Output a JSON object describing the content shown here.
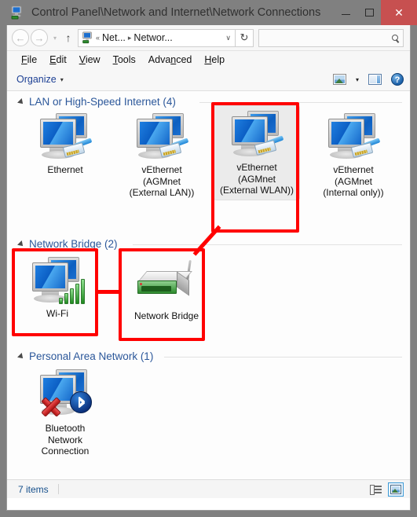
{
  "window": {
    "title": "Control Panel\\Network and Internet\\Network Connections",
    "icon": "network-connections-icon",
    "minimize_label": "–",
    "maximize_label": "",
    "close_label": "✕"
  },
  "addressbar": {
    "back_label": "←",
    "forward_label": "→",
    "history_label": "▾",
    "up_label": "↑",
    "crumb_overflow": "«",
    "crumb1": "Net...",
    "crumb_sep": "▸",
    "crumb2": "Networ...",
    "crumb_chevron": "∨",
    "refresh_label": "↻",
    "search_value": "",
    "search_placeholder": "",
    "search_icon": "search-icon"
  },
  "menubar": {
    "items": [
      {
        "label": "File",
        "accel": "F",
        "rest": "ile"
      },
      {
        "label": "Edit",
        "accel": "E",
        "rest": "dit"
      },
      {
        "label": "View",
        "accel": "V",
        "rest": "iew"
      },
      {
        "label": "Tools",
        "accel": "T",
        "rest": "ools"
      },
      {
        "label": "Advanced",
        "pre": "Adva",
        "accel": "n",
        "rest": "ced"
      },
      {
        "label": "Help",
        "accel": "H",
        "rest": "elp"
      }
    ]
  },
  "toolbar": {
    "organize_label": "Organize",
    "organize_caret": "▾",
    "view_icon": "picture-view-icon",
    "view_caret": "▾",
    "preview_pane_icon": "preview-pane-icon",
    "help_icon": "help-icon",
    "help_glyph": "?"
  },
  "groups": [
    {
      "name": "lan-or-high-speed-internet",
      "header": "LAN or High-Speed Internet (4)",
      "count": 4,
      "items": [
        {
          "name": "ethernet",
          "label": "Ethernet",
          "icon": "lan-adapter-icon",
          "selected": false,
          "annotated": false
        },
        {
          "name": "vethernet-external-lan",
          "label": "vEthernet\n(AGMnet\n(External LAN))",
          "icon": "lan-adapter-icon",
          "selected": false,
          "annotated": false
        },
        {
          "name": "vethernet-external-wlan",
          "label": "vEthernet\n(AGMnet\n(External WLAN))",
          "icon": "lan-adapter-icon",
          "selected": true,
          "annotated": true
        },
        {
          "name": "vethernet-internal-only",
          "label": "vEthernet\n(AGMnet\n(Internal only))",
          "icon": "lan-adapter-icon",
          "selected": false,
          "annotated": false
        }
      ]
    },
    {
      "name": "network-bridge",
      "header": "Network Bridge (2)",
      "count": 2,
      "items": [
        {
          "name": "wi-fi",
          "label": "Wi-Fi",
          "icon": "wireless-adapter-icon",
          "selected": false,
          "annotated": true
        },
        {
          "name": "network-bridge",
          "label": "Network Bridge",
          "icon": "network-bridge-device-icon",
          "selected": false,
          "annotated": true
        }
      ]
    },
    {
      "name": "personal-area-network",
      "header": "Personal Area Network (1)",
      "count": 1,
      "items": [
        {
          "name": "bluetooth-network-connection",
          "label": "Bluetooth\nNetwork\nConnection",
          "icon": "bluetooth-adapter-disconnected-icon",
          "selected": false,
          "annotated": false
        }
      ]
    }
  ],
  "annotation": {
    "color": "#ff0000",
    "boxes": [
      "vethernet-external-wlan",
      "wi-fi",
      "network-bridge"
    ],
    "connectors": [
      "wifi-to-bridge",
      "bridge-to-wlan"
    ]
  },
  "statusbar": {
    "item_count_text": "7 items",
    "details_view_icon": "details-view-icon",
    "large_icons_view_icon": "large-icons-view-icon",
    "active_view": "large-icons-view-icon"
  }
}
